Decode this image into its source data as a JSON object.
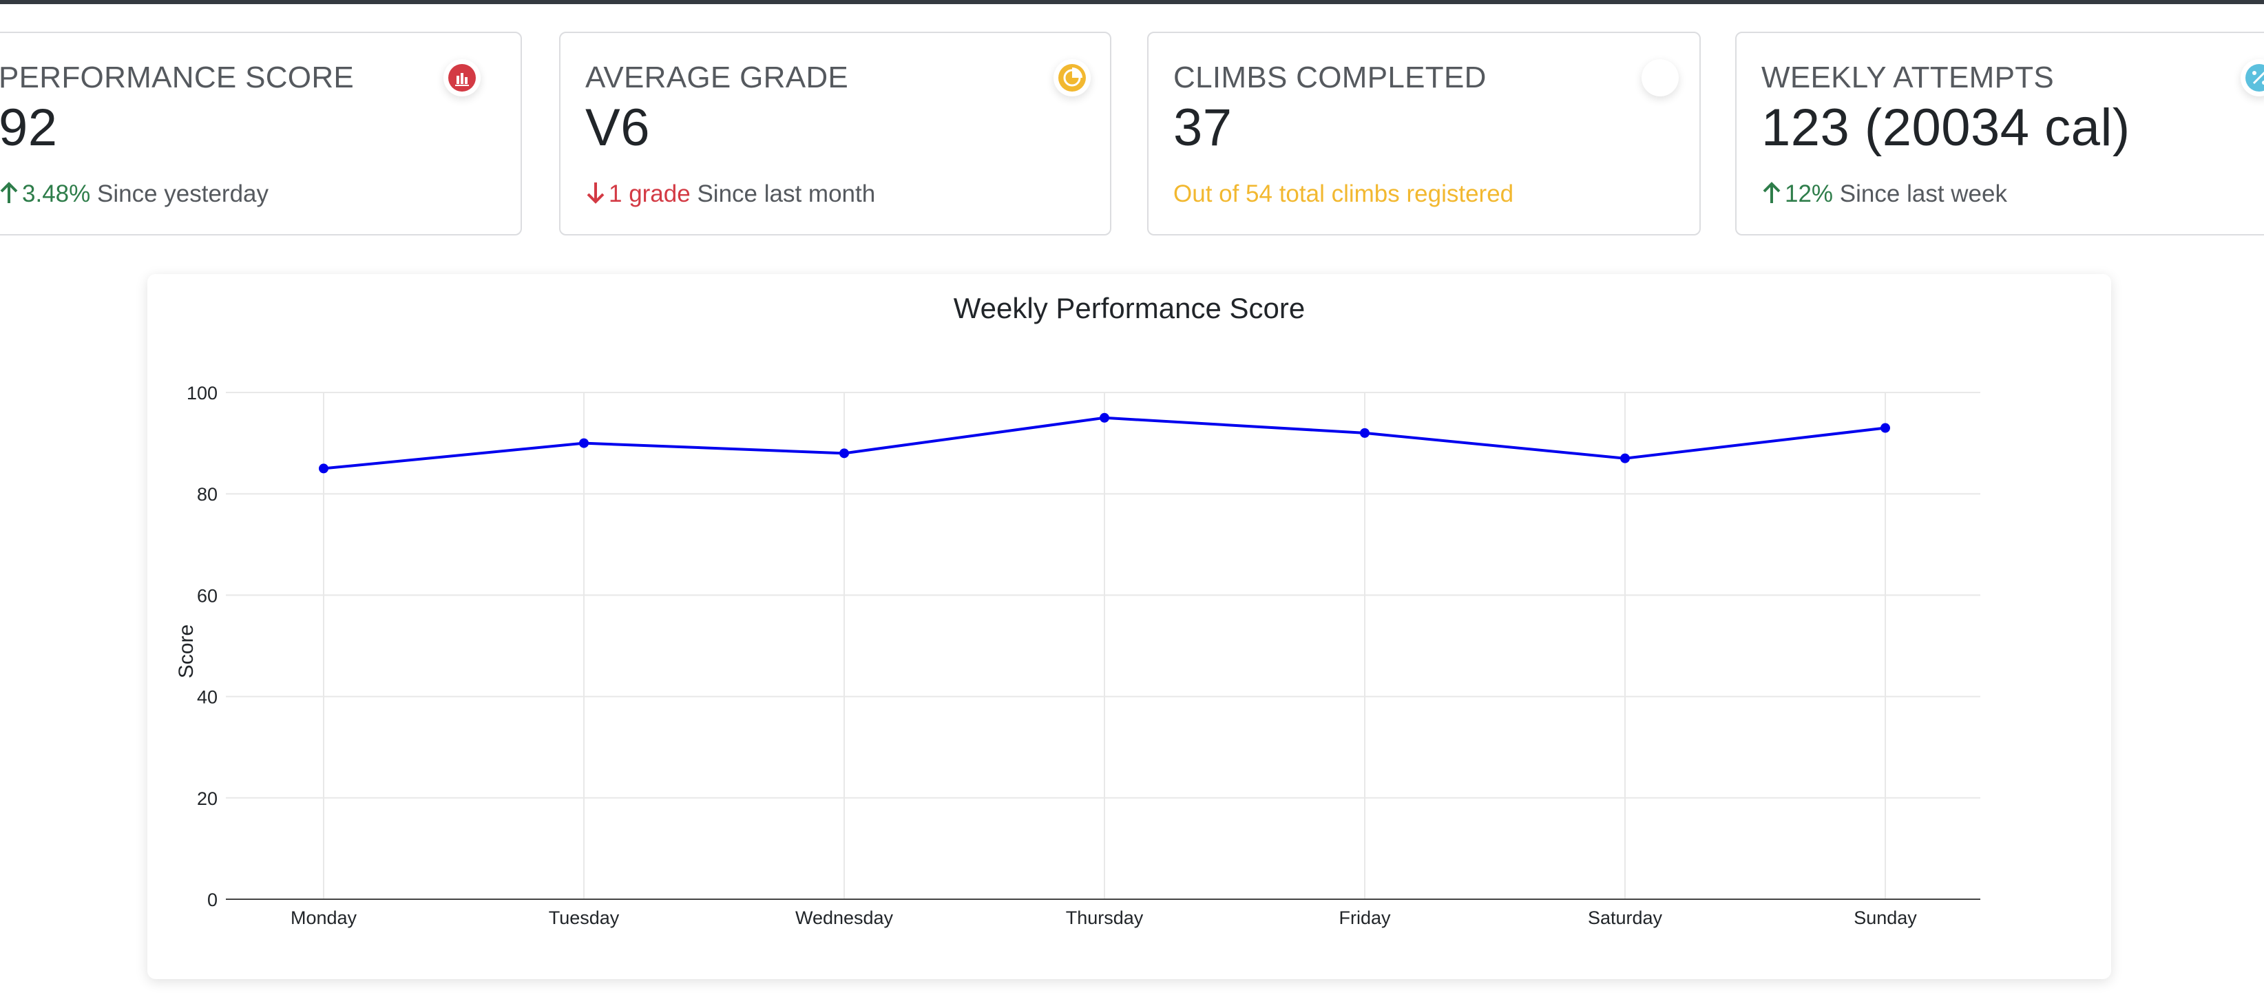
{
  "cards": [
    {
      "title": "Performance Score",
      "value": "92",
      "trend": "3.48%",
      "trend_dir": "up",
      "note": "Since yesterday",
      "icon": "chart-icon",
      "icon_color": "#d33a44"
    },
    {
      "title": "Average Grade",
      "value": "V6",
      "trend": "1 grade",
      "trend_dir": "down",
      "note": "Since last month",
      "icon": "pie-chart-icon",
      "icon_color": "#f2b830"
    },
    {
      "title": "Climbs Completed",
      "value": "37",
      "note_warn": "Out of 54 total climbs registered",
      "icon": "circle-icon"
    },
    {
      "title": "Weekly Attempts",
      "value": "123 (20034 cal)",
      "trend": "12%",
      "trend_dir": "up",
      "note": "Since last week",
      "icon": "percent-icon",
      "icon_color": "#5bc0de"
    }
  ],
  "colors": {
    "line": "#0000ee",
    "grid": "#e8e8e8",
    "up": "#2e7d4a",
    "down": "#d33a44",
    "warn": "#f2b830"
  },
  "chart_data": {
    "type": "line",
    "title": "Weekly Performance Score",
    "xlabel": "",
    "ylabel": "Score",
    "categories": [
      "Monday",
      "Tuesday",
      "Wednesday",
      "Thursday",
      "Friday",
      "Saturday",
      "Sunday"
    ],
    "values": [
      85,
      90,
      88,
      95,
      92,
      87,
      93
    ],
    "ylim": [
      0,
      100
    ],
    "yticks": [
      "0",
      "20",
      "40",
      "60",
      "80",
      "100"
    ],
    "grid": true
  }
}
